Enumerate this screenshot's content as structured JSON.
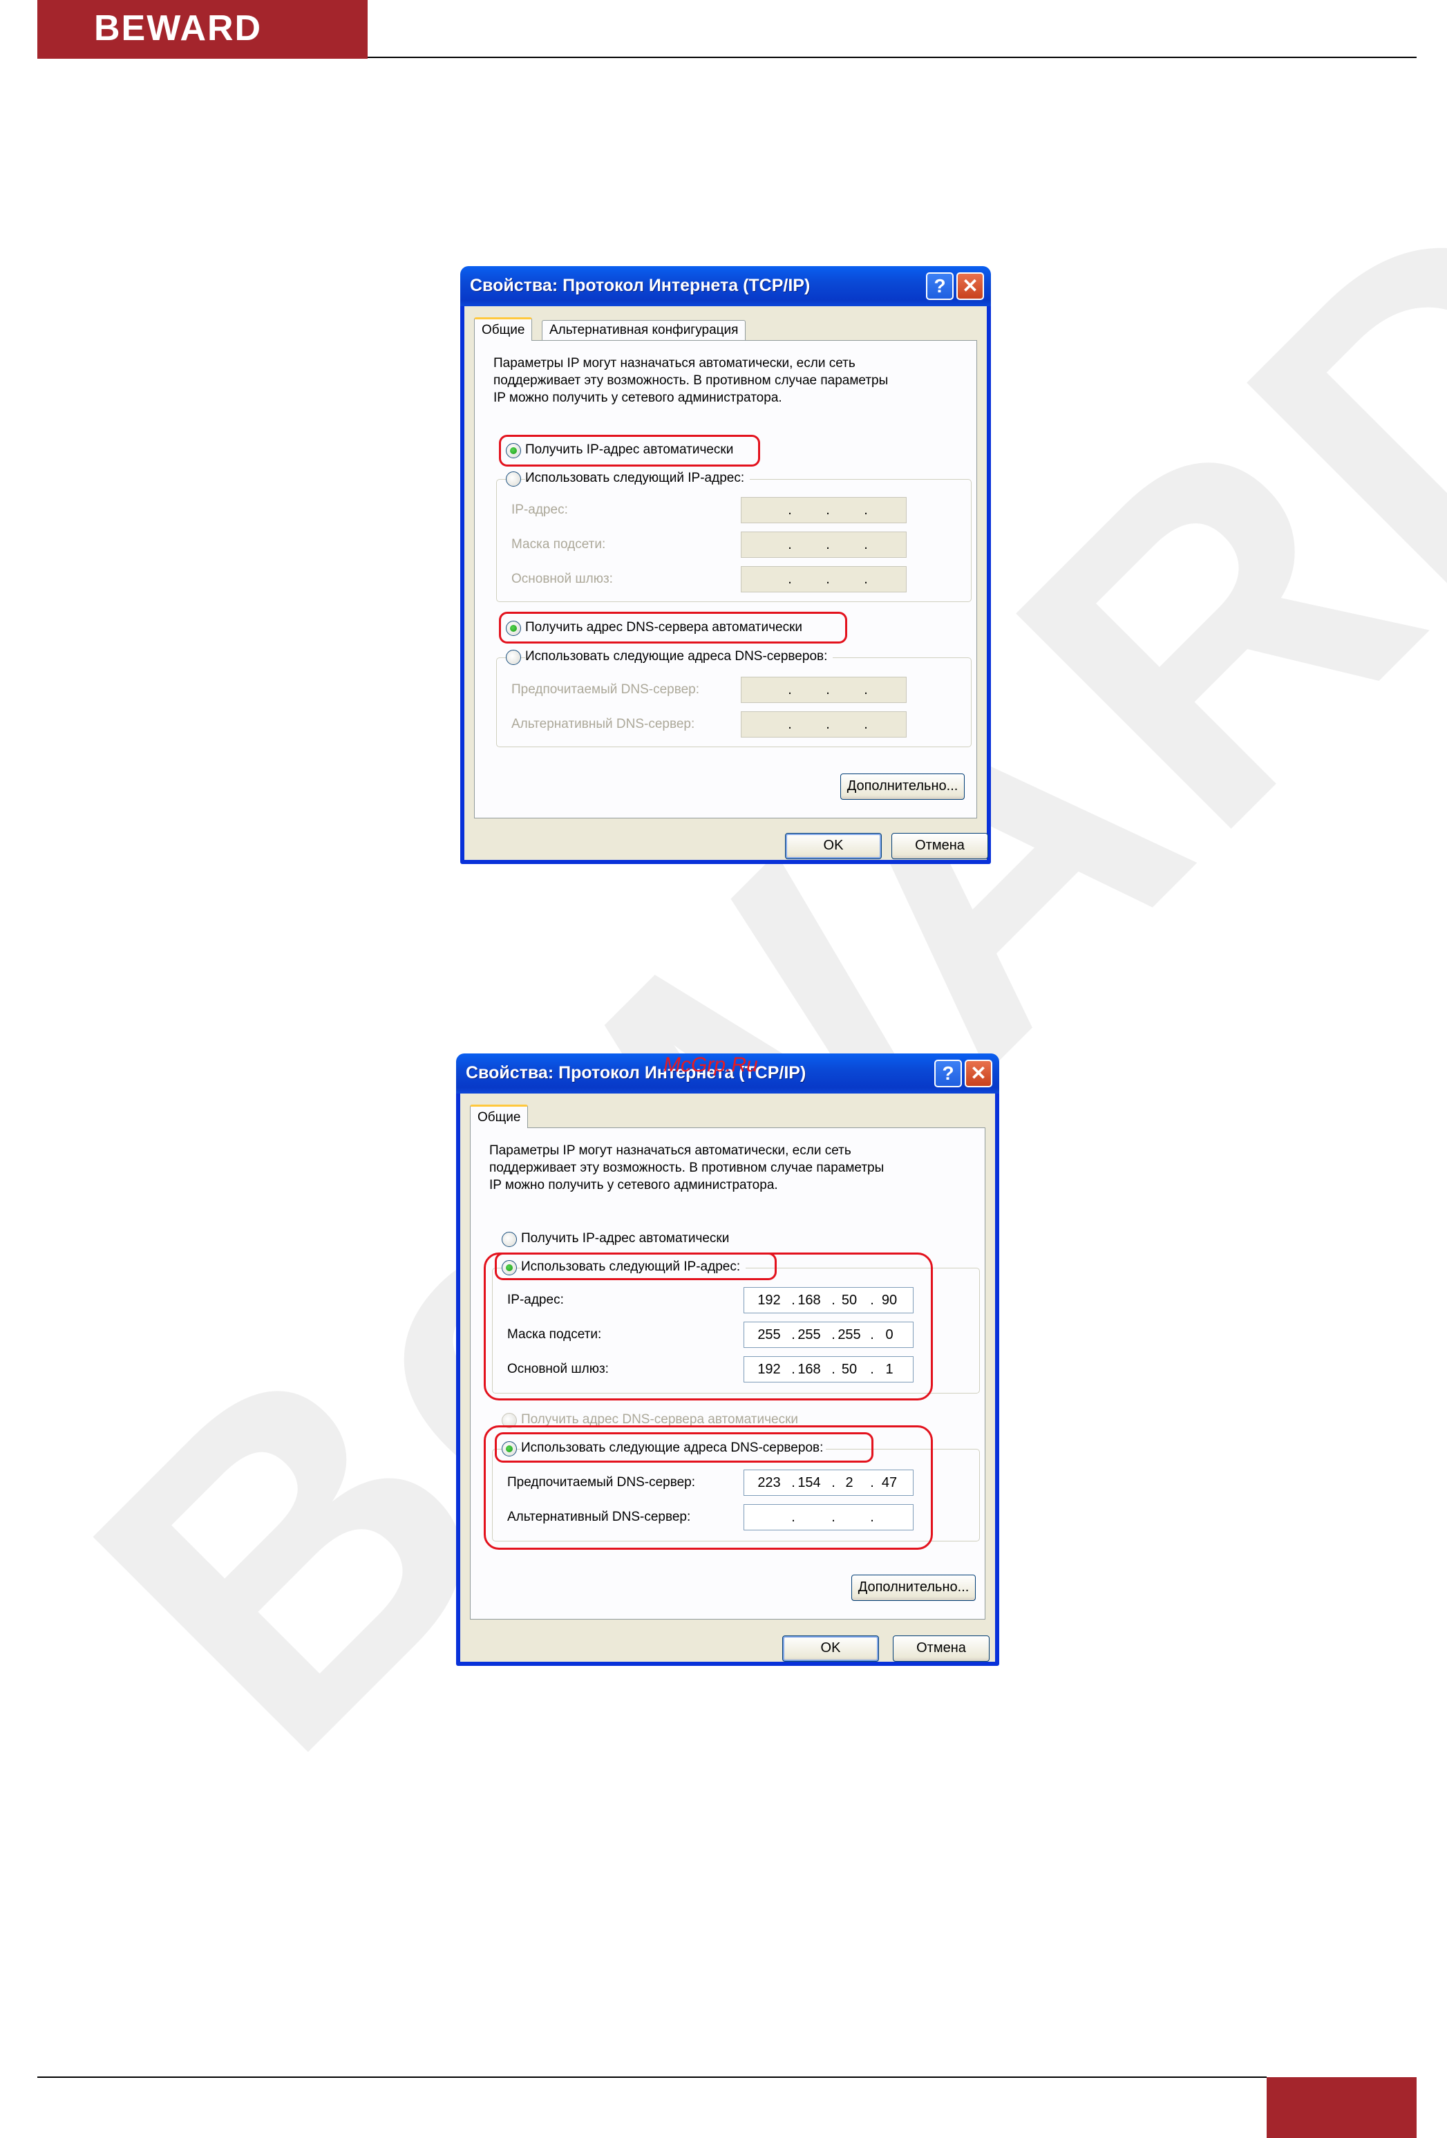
{
  "brand": {
    "logo": "BEWARD",
    "color": "#a4252c"
  },
  "dialogs": [
    {
      "title": "Свойства: Протокол Интернета (TCP/IP)",
      "tabs": [
        "Общие",
        "Альтернативная конфигурация"
      ],
      "intro": "Параметры IP могут назначаться автоматически, если сеть\nподдерживает эту возможность. В противном случае параметры\nIP можно получить у сетевого администратора.",
      "radio_ip_auto": "Получить IP-адрес автоматически",
      "radio_ip_manual": "Использовать следующий IP-адрес:",
      "label_ip": "IP-адрес:",
      "label_mask": "Маска подсети:",
      "label_gw": "Основной шлюз:",
      "radio_dns_auto": "Получить адрес DNS-сервера автоматически",
      "radio_dns_manual": "Использовать следующие адреса DNS-серверов:",
      "label_dns1": "Предпочитаемый DNS-сервер:",
      "label_dns2": "Альтернативный DNS-сервер:",
      "advanced": "Дополнительно...",
      "ok": "OK",
      "cancel": "Отмена",
      "ip_selected": "auto",
      "dns_selected": "auto"
    },
    {
      "title": "Свойства: Протокол Интернета (TCP/IP)",
      "overlay_text": "McGrp.Ru",
      "tabs": [
        "Общие"
      ],
      "intro": "Параметры IP могут назначаться автоматически, если сеть\nподдерживает эту возможность. В противном случае параметры\nIP можно получить у сетевого администратора.",
      "radio_ip_auto": "Получить IP-адрес автоматически",
      "radio_ip_manual": "Использовать следующий IP-адрес:",
      "label_ip": "IP-адрес:",
      "label_mask": "Маска подсети:",
      "label_gw": "Основной шлюз:",
      "ip": [
        "192",
        "168",
        "50",
        "90"
      ],
      "mask": [
        "255",
        "255",
        "255",
        "0"
      ],
      "gw": [
        "192",
        "168",
        "50",
        "1"
      ],
      "radio_dns_auto": "Получить адрес DNS-сервера автоматически",
      "radio_dns_manual": "Использовать следующие адреса DNS-серверов:",
      "label_dns1": "Предпочитаемый DNS-сервер:",
      "label_dns2": "Альтернативный DNS-сервер:",
      "dns1": [
        "223",
        "154",
        "2",
        "47"
      ],
      "advanced": "Дополнительно...",
      "ok": "OK",
      "cancel": "Отмена",
      "ip_selected": "manual",
      "dns_selected": "manual"
    }
  ],
  "highlight_color": "#e3121d"
}
